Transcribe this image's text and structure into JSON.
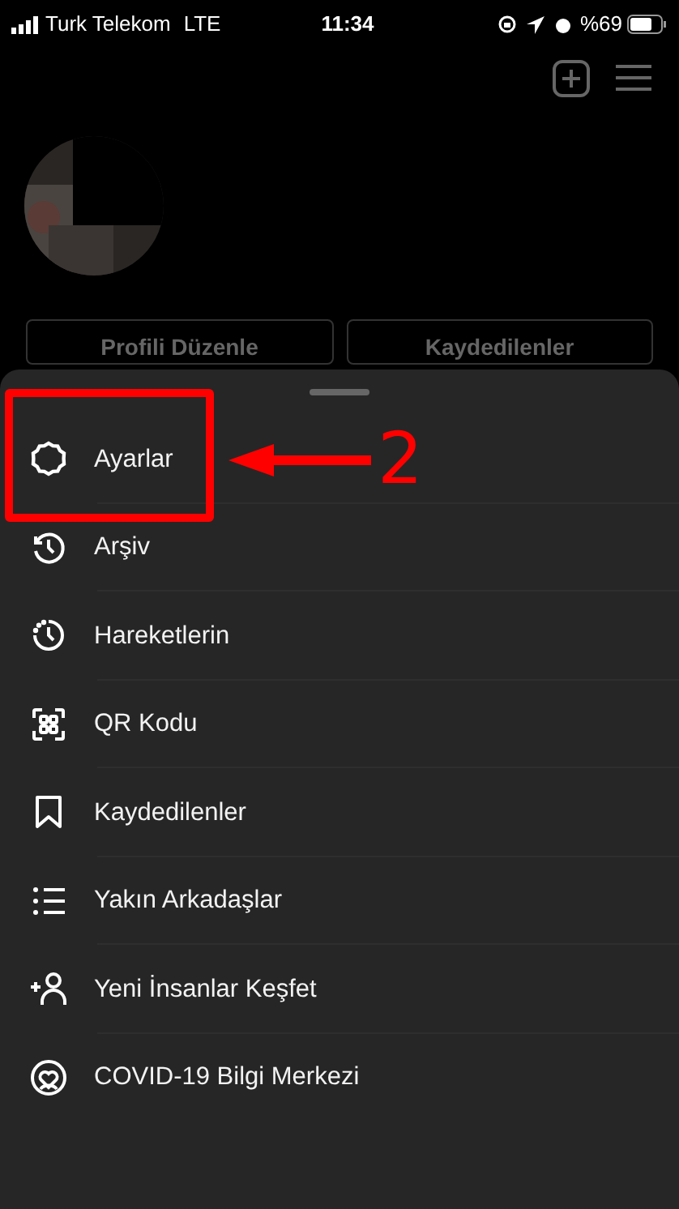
{
  "status_bar": {
    "carrier": "Turk Telekom",
    "network": "LTE",
    "time": "11:34",
    "battery": "%69"
  },
  "profile_buttons": [
    "Profili Düzenle",
    "Kaydedilenler"
  ],
  "menu": [
    {
      "label": "Ayarlar",
      "highlighted": true
    },
    {
      "label": "Arşiv",
      "highlighted": false
    },
    {
      "label": "Hareketlerin",
      "highlighted": false
    },
    {
      "label": "QR Kodu",
      "highlighted": false
    },
    {
      "label": "Kaydedilenler",
      "highlighted": false
    },
    {
      "label": "Yakın Arkadaşlar",
      "highlighted": false
    },
    {
      "label": "Yeni İnsanlar Keşfet",
      "highlighted": false
    },
    {
      "label": "COVID-19 Bilgi Merkezi",
      "highlighted": false
    }
  ],
  "annotation": {
    "label": "2"
  }
}
